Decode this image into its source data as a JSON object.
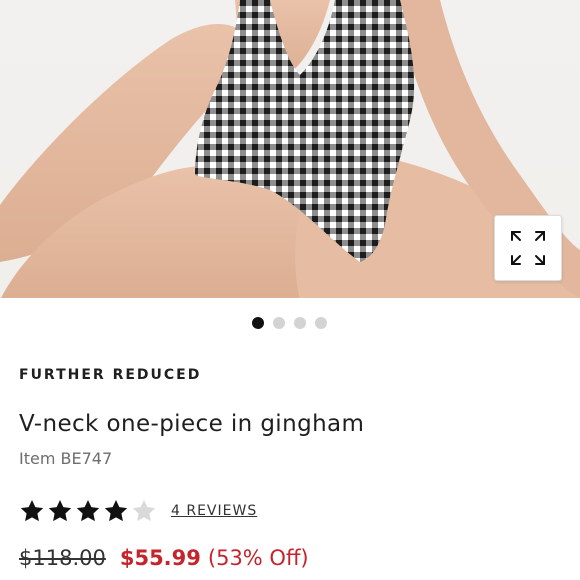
{
  "carousel": {
    "slide_count": 4,
    "active_index": 0
  },
  "product": {
    "badge": "FURTHER REDUCED",
    "title": "V-neck one-piece in gingham",
    "item_number": "Item BE747",
    "rating": 4,
    "rating_max": 5,
    "reviews_label": "4 REVIEWS",
    "price_original": "$118.00",
    "price_sale": "$55.99",
    "discount": "(53% Off)"
  },
  "colors": {
    "sale": "#c4242b",
    "star_filled": "#111111",
    "star_empty": "#d9d9d9",
    "dot_active": "#111111",
    "dot_inactive": "#d3d3d3"
  },
  "icons": {
    "expand": "expand-arrows-icon",
    "star": "star-icon"
  }
}
